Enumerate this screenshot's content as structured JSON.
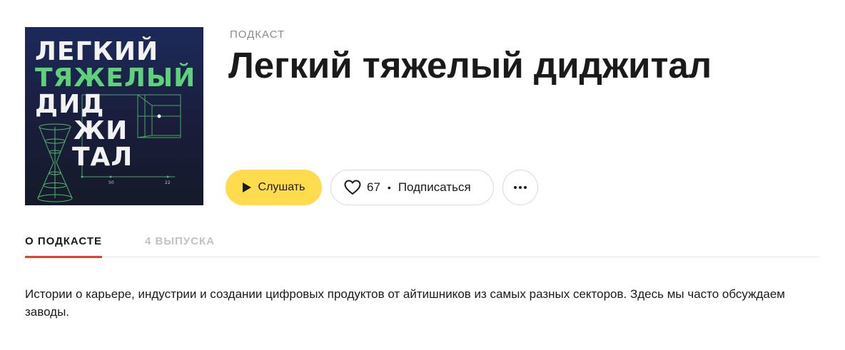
{
  "cover": {
    "lines": [
      "ЛЕГКИЙ",
      "ТЯЖЕЛЫЙ",
      "ДИД",
      "ЖИ",
      "ТАЛ"
    ],
    "axis_labels": [
      "50",
      "22"
    ],
    "accent_color": "#5fd17a"
  },
  "header": {
    "type_label": "ПОДКАСТ",
    "title": "Легкий тяжелый диджитал"
  },
  "actions": {
    "listen_label": "Слушать",
    "likes_count": "67",
    "separator": "•",
    "subscribe_label": "Подписаться",
    "listen_color": "#ffdb4d"
  },
  "tabs": [
    {
      "label": "О ПОДКАСТЕ",
      "active": true
    },
    {
      "label": "4 ВЫПУСКА",
      "active": false
    }
  ],
  "description": "Истории о карьере, индустрии и создании цифровых продуктов от айтишников из самых разных секторов. Здесь мы часто обсуждаем заводы."
}
